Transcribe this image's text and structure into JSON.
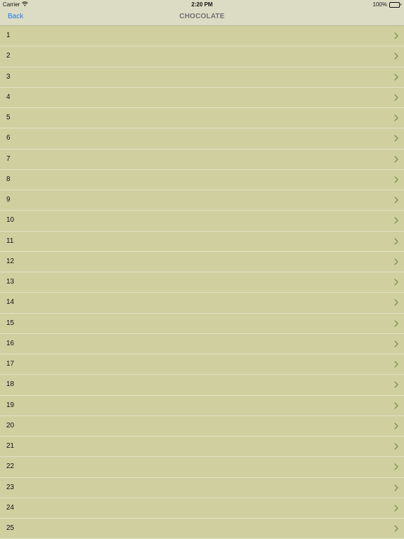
{
  "status_bar": {
    "carrier": "Carrier",
    "time": "2:20 PM",
    "battery_label": "100%",
    "battery_level": 1.0
  },
  "nav": {
    "back_label": "Back",
    "title": "CHOCOLATE"
  },
  "list": {
    "items": [
      {
        "label": "1"
      },
      {
        "label": "2"
      },
      {
        "label": "3"
      },
      {
        "label": "4"
      },
      {
        "label": "5"
      },
      {
        "label": "6"
      },
      {
        "label": "7"
      },
      {
        "label": "8"
      },
      {
        "label": "9"
      },
      {
        "label": "10"
      },
      {
        "label": "11"
      },
      {
        "label": "12"
      },
      {
        "label": "13"
      },
      {
        "label": "14"
      },
      {
        "label": "15"
      },
      {
        "label": "16"
      },
      {
        "label": "17"
      },
      {
        "label": "18"
      },
      {
        "label": "19"
      },
      {
        "label": "20"
      },
      {
        "label": "21"
      },
      {
        "label": "22"
      },
      {
        "label": "23"
      },
      {
        "label": "24"
      },
      {
        "label": "25"
      }
    ],
    "disclosure_icon": "chevron-right-icon"
  },
  "colors": {
    "background": "#cfcfa0",
    "bar_background": "#dcdcc4",
    "separator": "#e2e2c4",
    "back_link": "#1a7cf0",
    "title": "#707070",
    "chevron": "#6b8a3c"
  }
}
